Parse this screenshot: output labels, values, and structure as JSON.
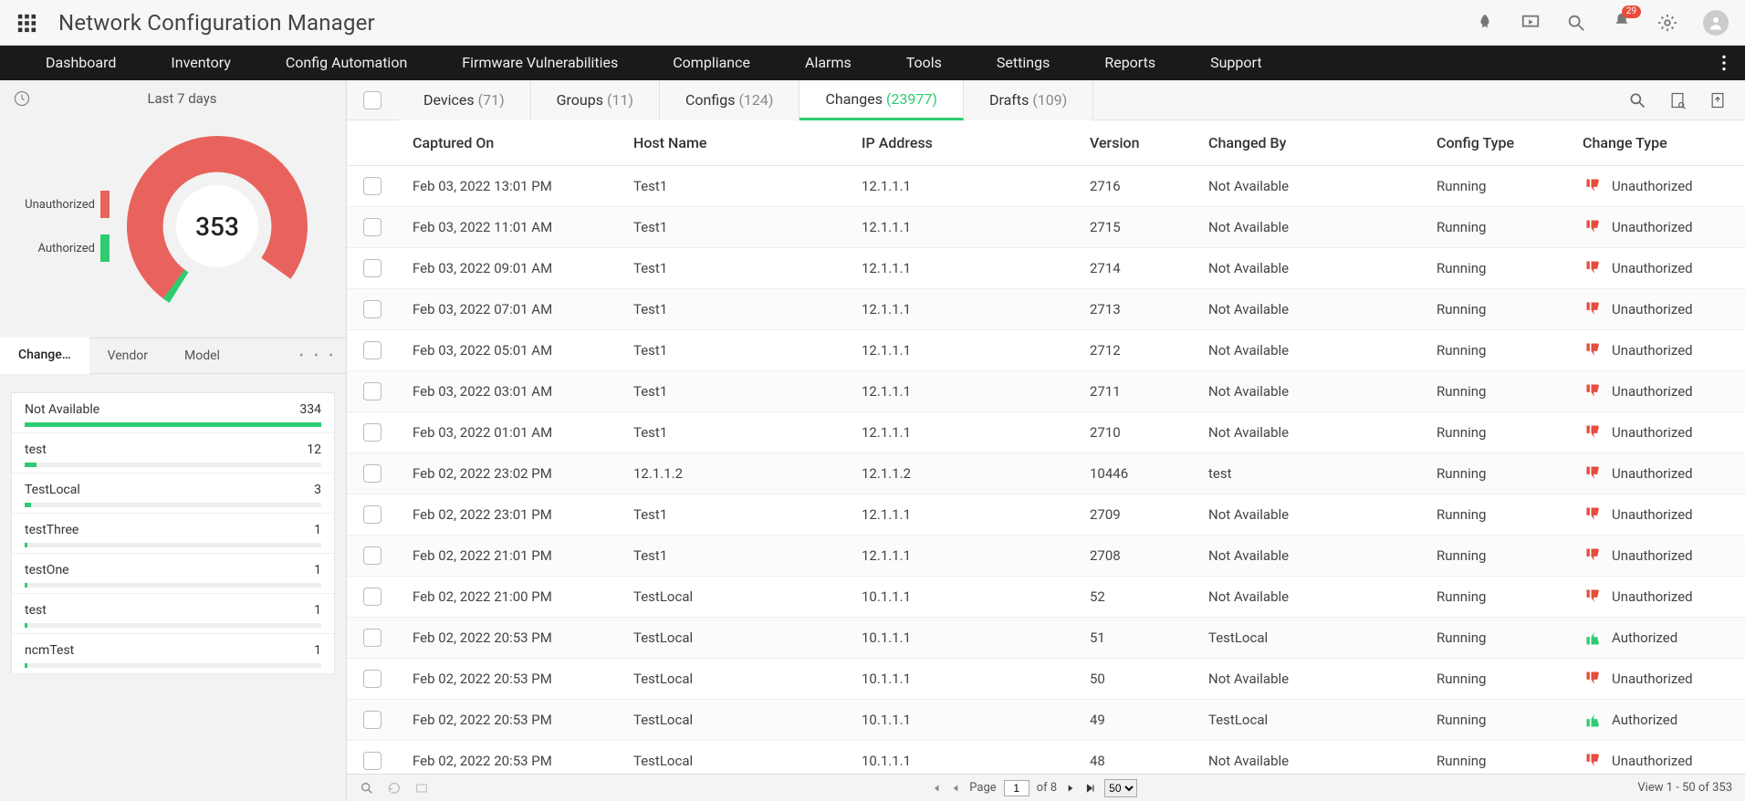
{
  "header": {
    "app_title": "Network Configuration Manager",
    "notification_count": "29"
  },
  "nav": {
    "items": [
      "Dashboard",
      "Inventory",
      "Config Automation",
      "Firmware Vulnerabilities",
      "Compliance",
      "Alarms",
      "Tools",
      "Settings",
      "Reports",
      "Support"
    ]
  },
  "sidebar": {
    "range_label": "Last 7 days",
    "legend": {
      "unauthorized": "Unauthorized",
      "authorized": "Authorized"
    },
    "total": "353",
    "tabs": {
      "change": "Change…",
      "vendor": "Vendor",
      "model": "Model"
    },
    "list": [
      {
        "label": "Not Available",
        "count": "334",
        "pct": 100
      },
      {
        "label": "test",
        "count": "12",
        "pct": 4
      },
      {
        "label": "TestLocal",
        "count": "3",
        "pct": 2
      },
      {
        "label": "testThree",
        "count": "1",
        "pct": 1
      },
      {
        "label": "testOne",
        "count": "1",
        "pct": 1
      },
      {
        "label": "test",
        "count": "1",
        "pct": 1
      },
      {
        "label": "ncmTest",
        "count": "1",
        "pct": 1
      }
    ]
  },
  "chart_data": {
    "type": "pie",
    "title": "Last 7 days",
    "series": [
      {
        "name": "Unauthorized",
        "value": 349,
        "color": "#e8635d"
      },
      {
        "name": "Authorized",
        "value": 4,
        "color": "#2ecc71"
      }
    ],
    "total": 353
  },
  "tabs": [
    {
      "label": "Devices",
      "count": "(71)",
      "active": false
    },
    {
      "label": "Groups",
      "count": "(11)",
      "active": false
    },
    {
      "label": "Configs",
      "count": "(124)",
      "active": false
    },
    {
      "label": "Changes",
      "count": "(23977)",
      "active": true
    },
    {
      "label": "Drafts",
      "count": "(109)",
      "active": false
    }
  ],
  "columns": {
    "captured": "Captured On",
    "host": "Host Name",
    "ip": "IP Address",
    "version": "Version",
    "changedby": "Changed By",
    "config": "Config Type",
    "change": "Change Type"
  },
  "change_labels": {
    "unauth": "Unauthorized",
    "auth": "Authorized"
  },
  "rows": [
    {
      "captured": "Feb 03, 2022 13:01 PM",
      "host": "Test1",
      "ip": "12.1.1.1",
      "version": "2716",
      "by": "Not Available",
      "cfg": "Running",
      "auth": false
    },
    {
      "captured": "Feb 03, 2022 11:01 AM",
      "host": "Test1",
      "ip": "12.1.1.1",
      "version": "2715",
      "by": "Not Available",
      "cfg": "Running",
      "auth": false
    },
    {
      "captured": "Feb 03, 2022 09:01 AM",
      "host": "Test1",
      "ip": "12.1.1.1",
      "version": "2714",
      "by": "Not Available",
      "cfg": "Running",
      "auth": false
    },
    {
      "captured": "Feb 03, 2022 07:01 AM",
      "host": "Test1",
      "ip": "12.1.1.1",
      "version": "2713",
      "by": "Not Available",
      "cfg": "Running",
      "auth": false
    },
    {
      "captured": "Feb 03, 2022 05:01 AM",
      "host": "Test1",
      "ip": "12.1.1.1",
      "version": "2712",
      "by": "Not Available",
      "cfg": "Running",
      "auth": false
    },
    {
      "captured": "Feb 03, 2022 03:01 AM",
      "host": "Test1",
      "ip": "12.1.1.1",
      "version": "2711",
      "by": "Not Available",
      "cfg": "Running",
      "auth": false
    },
    {
      "captured": "Feb 03, 2022 01:01 AM",
      "host": "Test1",
      "ip": "12.1.1.1",
      "version": "2710",
      "by": "Not Available",
      "cfg": "Running",
      "auth": false
    },
    {
      "captured": "Feb 02, 2022 23:02 PM",
      "host": "12.1.1.2",
      "ip": "12.1.1.2",
      "version": "10446",
      "by": "test",
      "cfg": "Running",
      "auth": false
    },
    {
      "captured": "Feb 02, 2022 23:01 PM",
      "host": "Test1",
      "ip": "12.1.1.1",
      "version": "2709",
      "by": "Not Available",
      "cfg": "Running",
      "auth": false
    },
    {
      "captured": "Feb 02, 2022 21:01 PM",
      "host": "Test1",
      "ip": "12.1.1.1",
      "version": "2708",
      "by": "Not Available",
      "cfg": "Running",
      "auth": false
    },
    {
      "captured": "Feb 02, 2022 21:00 PM",
      "host": "TestLocal",
      "ip": "10.1.1.1",
      "version": "52",
      "by": "Not Available",
      "cfg": "Running",
      "auth": false
    },
    {
      "captured": "Feb 02, 2022 20:53 PM",
      "host": "TestLocal",
      "ip": "10.1.1.1",
      "version": "51",
      "by": "TestLocal",
      "cfg": "Running",
      "auth": true
    },
    {
      "captured": "Feb 02, 2022 20:53 PM",
      "host": "TestLocal",
      "ip": "10.1.1.1",
      "version": "50",
      "by": "Not Available",
      "cfg": "Running",
      "auth": false
    },
    {
      "captured": "Feb 02, 2022 20:53 PM",
      "host": "TestLocal",
      "ip": "10.1.1.1",
      "version": "49",
      "by": "TestLocal",
      "cfg": "Running",
      "auth": true
    },
    {
      "captured": "Feb 02, 2022 20:53 PM",
      "host": "TestLocal",
      "ip": "10.1.1.1",
      "version": "48",
      "by": "Not Available",
      "cfg": "Running",
      "auth": false
    }
  ],
  "footer": {
    "page_label": "Page",
    "page_value": "1",
    "of_label": "of 8",
    "page_size": "50",
    "view_label": "View 1 - 50 of 353"
  }
}
